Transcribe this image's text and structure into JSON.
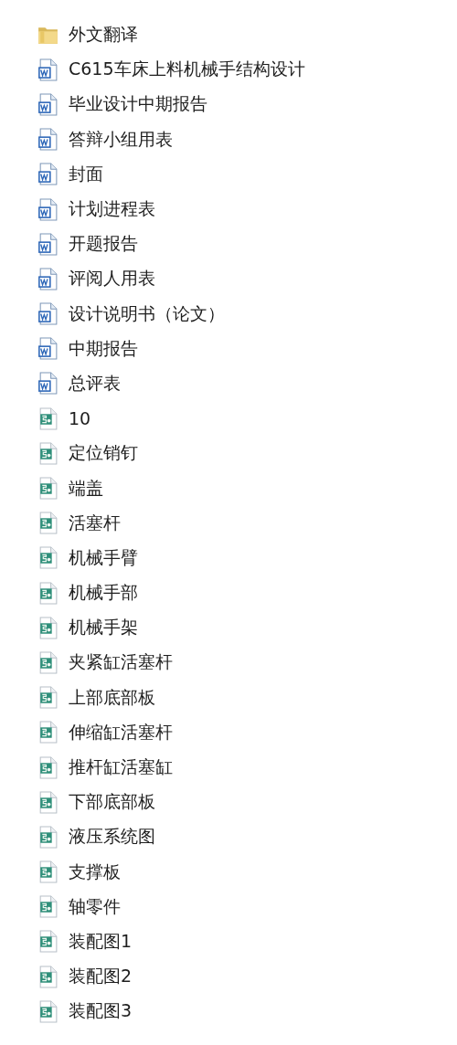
{
  "files": [
    {
      "name": "外文翻译",
      "kind": "folder"
    },
    {
      "name": "C615车床上料机械手结构设计",
      "kind": "word"
    },
    {
      "name": "毕业设计中期报告",
      "kind": "word"
    },
    {
      "name": "答辩小组用表",
      "kind": "word"
    },
    {
      "name": "封面",
      "kind": "word"
    },
    {
      "name": "计划进程表",
      "kind": "word"
    },
    {
      "name": "开题报告",
      "kind": "word"
    },
    {
      "name": "评阅人用表",
      "kind": "word"
    },
    {
      "name": "设计说明书（论文）",
      "kind": "word"
    },
    {
      "name": "中期报告",
      "kind": "word"
    },
    {
      "name": "总评表",
      "kind": "word"
    },
    {
      "name": "10",
      "kind": "drawing"
    },
    {
      "name": "定位销钉",
      "kind": "drawing"
    },
    {
      "name": "端盖",
      "kind": "drawing"
    },
    {
      "name": "活塞杆",
      "kind": "drawing"
    },
    {
      "name": "机械手臂",
      "kind": "drawing"
    },
    {
      "name": "机械手部",
      "kind": "drawing"
    },
    {
      "name": "机械手架",
      "kind": "drawing"
    },
    {
      "name": "夹紧缸活塞杆",
      "kind": "drawing"
    },
    {
      "name": "上部底部板",
      "kind": "drawing"
    },
    {
      "name": "伸缩缸活塞杆",
      "kind": "drawing"
    },
    {
      "name": "推杆缸活塞缸",
      "kind": "drawing"
    },
    {
      "name": "下部底部板",
      "kind": "drawing"
    },
    {
      "name": "液压系统图",
      "kind": "drawing"
    },
    {
      "name": "支撑板",
      "kind": "drawing"
    },
    {
      "name": "轴零件",
      "kind": "drawing"
    },
    {
      "name": "装配图1",
      "kind": "drawing"
    },
    {
      "name": "装配图2",
      "kind": "drawing"
    },
    {
      "name": "装配图3",
      "kind": "drawing"
    }
  ]
}
